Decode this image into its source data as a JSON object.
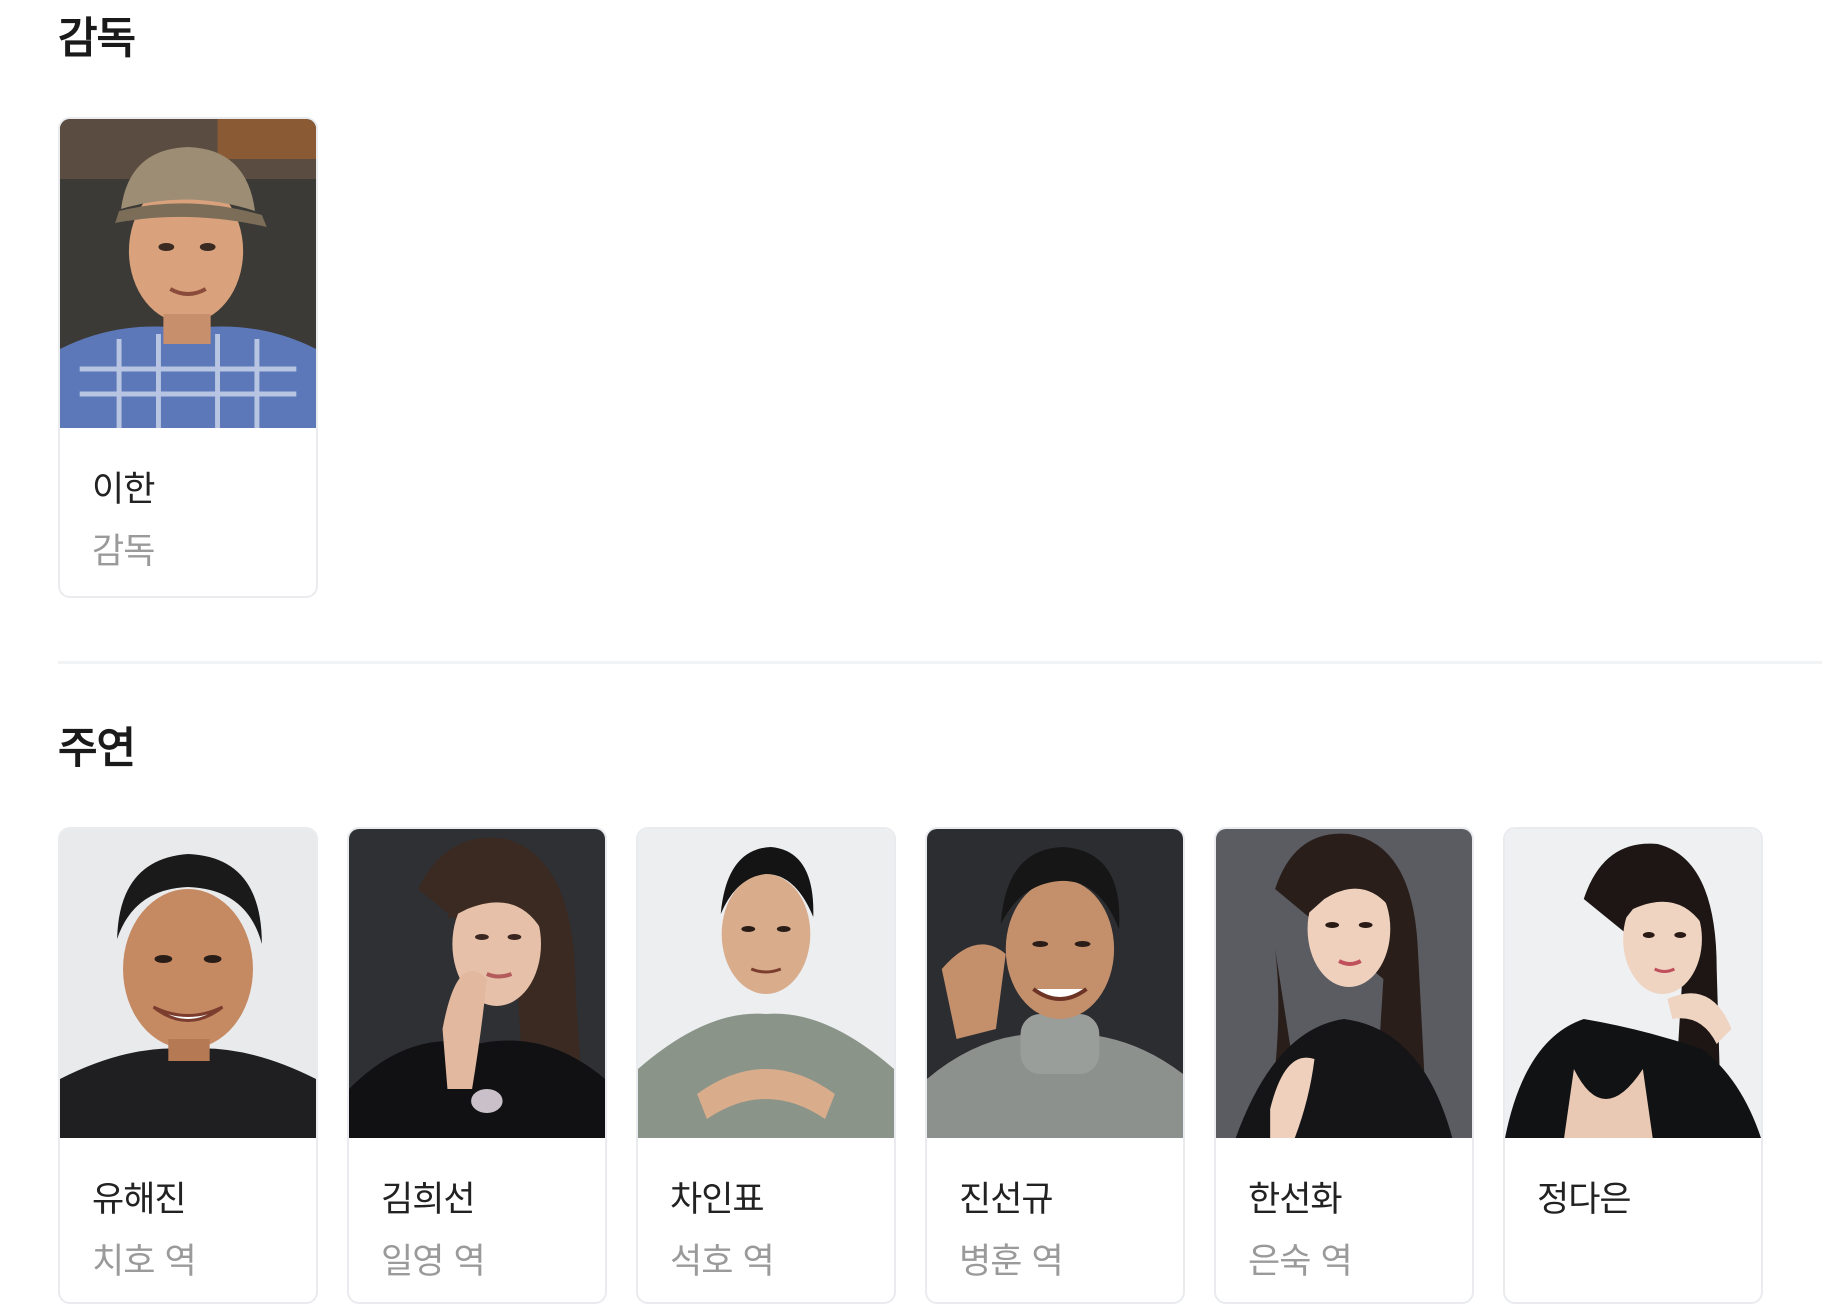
{
  "director_section": {
    "title": "감독",
    "people": [
      {
        "name": "이한",
        "role": "감독"
      }
    ]
  },
  "cast_section": {
    "title": "주연",
    "people": [
      {
        "name": "유해진",
        "role": "치호 역"
      },
      {
        "name": "김희선",
        "role": "일영 역"
      },
      {
        "name": "차인표",
        "role": "석호 역"
      },
      {
        "name": "진선규",
        "role": "병훈 역"
      },
      {
        "name": "한선화",
        "role": "은숙 역"
      },
      {
        "name": "정다은",
        "role": ""
      }
    ]
  }
}
